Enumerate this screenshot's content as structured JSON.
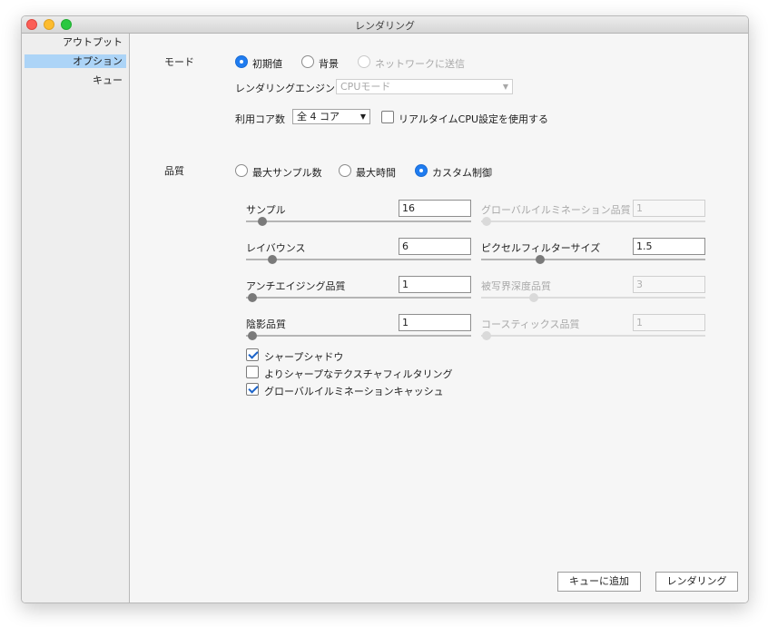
{
  "window": {
    "title": "レンダリング"
  },
  "sidebar": {
    "items": [
      {
        "label": "アウトプット"
      },
      {
        "label": "オプション",
        "selected": true
      },
      {
        "label": "キュー"
      }
    ]
  },
  "mode": {
    "label": "モード",
    "options": [
      {
        "label": "初期値",
        "selected": true,
        "enabled": true
      },
      {
        "label": "背景",
        "selected": false,
        "enabled": true
      },
      {
        "label": "ネットワークに送信",
        "selected": false,
        "enabled": false
      }
    ],
    "engine_label": "レンダリングエンジン",
    "engine_value": "CPUモード",
    "cores_label": "利用コア数",
    "cores_value": "全 4 コア",
    "realtime_checkbox": {
      "label": "リアルタイムCPU設定を使用する",
      "checked": false
    }
  },
  "quality": {
    "label": "品質",
    "options": [
      {
        "label": "最大サンプル数",
        "selected": false
      },
      {
        "label": "最大時間",
        "selected": false
      },
      {
        "label": "カスタム制御",
        "selected": true
      }
    ],
    "left_params": [
      {
        "label": "サンプル",
        "value": "16"
      },
      {
        "label": "レイバウンス",
        "value": "6"
      },
      {
        "label": "アンチエイジング品質",
        "value": "1"
      },
      {
        "label": "陰影品質",
        "value": "1"
      }
    ],
    "right_params": [
      {
        "label": "グローバルイルミネーション品質",
        "value": "1",
        "enabled": false
      },
      {
        "label": "ピクセルフィルターサイズ",
        "value": "1.5",
        "enabled": true
      },
      {
        "label": "被写界深度品質",
        "value": "3",
        "enabled": false
      },
      {
        "label": "コースティックス品質",
        "value": "1",
        "enabled": false
      }
    ],
    "checkboxes": [
      {
        "label": "シャープシャドウ",
        "checked": true
      },
      {
        "label": "よりシャープなテクスチャフィルタリング",
        "checked": false
      },
      {
        "label": "グローバルイルミネーションキャッシュ",
        "checked": true
      }
    ]
  },
  "footer": {
    "add_to_queue_label": "キューに追加",
    "render_label": "レンダリング"
  }
}
